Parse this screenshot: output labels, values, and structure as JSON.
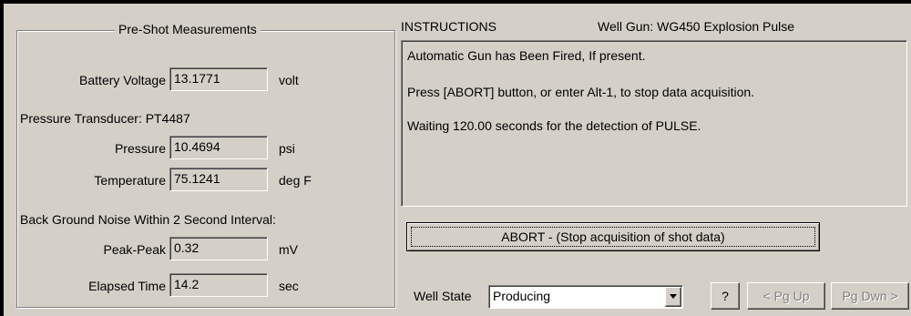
{
  "pre_shot": {
    "title": "Pre-Shot Measurements",
    "battery_voltage": {
      "label": "Battery Voltage",
      "value": "13.1771",
      "unit": "volt"
    },
    "transducer_label": "Pressure Transducer: PT4487",
    "pressure": {
      "label": "Pressure",
      "value": "10.4694",
      "unit": "psi"
    },
    "temperature": {
      "label": "Temperature",
      "value": "75.1241",
      "unit": "deg F"
    },
    "noise_label": "Back Ground Noise Within 2 Second Interval:",
    "peak_peak": {
      "label": "Peak-Peak",
      "value": "0.32",
      "unit": "mV"
    },
    "elapsed_time": {
      "label": "Elapsed Time",
      "value": "14.2",
      "unit": "sec"
    }
  },
  "instructions": {
    "title": "INSTRUCTIONS",
    "gun_label": "Well Gun: WG450 Explosion Pulse",
    "lines": [
      "Automatic Gun has Been Fired, If present.",
      "Press [ABORT] button, or enter Alt-1, to stop data acquisition.",
      "Waiting 120.00 seconds for the detection of PULSE."
    ]
  },
  "abort_button": {
    "label": "ABORT - (Stop acquisition of shot data)"
  },
  "well_state": {
    "label": "Well State",
    "value": "Producing"
  },
  "buttons": {
    "help": "?",
    "pg_up": "< Pg Up",
    "pg_down": "Pg Dwn >"
  },
  "colors": {
    "face": "#d4d0c8",
    "shadow": "#808080",
    "highlight": "#ffffff",
    "disabled_text": "#808080"
  }
}
